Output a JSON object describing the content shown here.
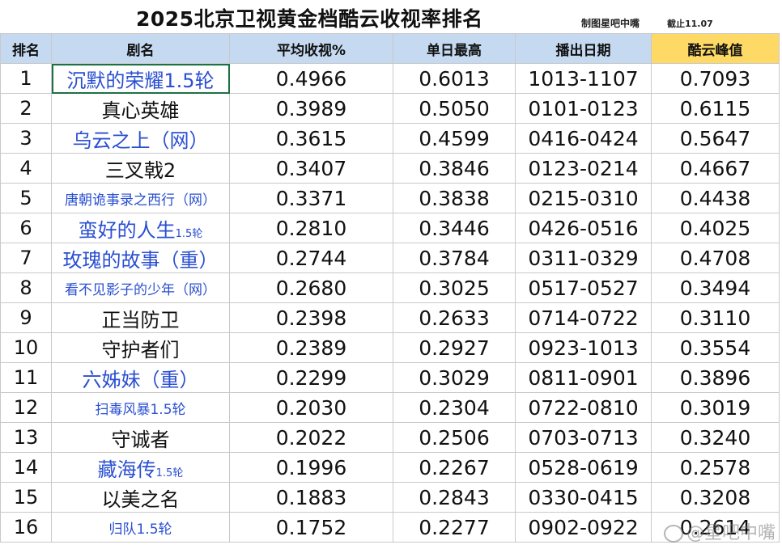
{
  "title": "2025北京卫视黄金档酷云收视率排名",
  "credit": "制图星吧中嘴",
  "cutoff": "截止11.07",
  "watermark": "@星吧中嘴",
  "headers": [
    "排名",
    "剧名",
    "平均收视%",
    "单日最高",
    "播出日期",
    "酷云峰值"
  ],
  "colors": {
    "header_bg": "#c5d9f1",
    "peak_header_bg": "#ffd966",
    "blue_text": "#2a4fd1",
    "selection": "#1e7145"
  },
  "rows": [
    {
      "rank": "1",
      "name": "沉默的荣耀1.5轮",
      "sub": "",
      "avg": "0.4966",
      "max": "0.6013",
      "dates": "1013-1107",
      "peak": "0.7093",
      "blue": true,
      "small": false
    },
    {
      "rank": "2",
      "name": "真心英雄",
      "sub": "",
      "avg": "0.3989",
      "max": "0.5050",
      "dates": "0101-0123",
      "peak": "0.6115",
      "blue": false,
      "small": false
    },
    {
      "rank": "3",
      "name": "乌云之上（网）",
      "sub": "",
      "avg": "0.3615",
      "max": "0.4599",
      "dates": "0416-0424",
      "peak": "0.5647",
      "blue": true,
      "small": false
    },
    {
      "rank": "4",
      "name": "三叉戟2",
      "sub": "",
      "avg": "0.3407",
      "max": "0.3846",
      "dates": "0123-0214",
      "peak": "0.4667",
      "blue": false,
      "small": false
    },
    {
      "rank": "5",
      "name": "唐朝诡事录之西行（网）",
      "sub": "",
      "avg": "0.3371",
      "max": "0.3838",
      "dates": "0215-0310",
      "peak": "0.4438",
      "blue": true,
      "small": true
    },
    {
      "rank": "6",
      "name": "蛮好的人生",
      "sub": "1.5轮",
      "avg": "0.2810",
      "max": "0.3446",
      "dates": "0426-0516",
      "peak": "0.4025",
      "blue": true,
      "small": false
    },
    {
      "rank": "7",
      "name": "玫瑰的故事（重）",
      "sub": "",
      "avg": "0.2744",
      "max": "0.3784",
      "dates": "0311-0329",
      "peak": "0.4708",
      "blue": true,
      "small": false
    },
    {
      "rank": "8",
      "name": "看不见影子的少年（网）",
      "sub": "",
      "avg": "0.2680",
      "max": "0.3025",
      "dates": "0517-0527",
      "peak": "0.3494",
      "blue": true,
      "small": true
    },
    {
      "rank": "9",
      "name": "正当防卫",
      "sub": "",
      "avg": "0.2398",
      "max": "0.2633",
      "dates": "0714-0722",
      "peak": "0.3110",
      "blue": false,
      "small": false
    },
    {
      "rank": "10",
      "name": "守护者们",
      "sub": "",
      "avg": "0.2389",
      "max": "0.2927",
      "dates": "0923-1013",
      "peak": "0.3554",
      "blue": false,
      "small": false
    },
    {
      "rank": "11",
      "name": "六姊妹（重）",
      "sub": "",
      "avg": "0.2299",
      "max": "0.3029",
      "dates": "0811-0901",
      "peak": "0.3896",
      "blue": true,
      "small": false
    },
    {
      "rank": "12",
      "name": "扫毒风暴1.5轮",
      "sub": "",
      "avg": "0.2030",
      "max": "0.2304",
      "dates": "0722-0810",
      "peak": "0.3019",
      "blue": true,
      "small": true
    },
    {
      "rank": "13",
      "name": "守诚者",
      "sub": "",
      "avg": "0.2022",
      "max": "0.2506",
      "dates": "0703-0713",
      "peak": "0.3240",
      "blue": false,
      "small": false
    },
    {
      "rank": "14",
      "name": "藏海传",
      "sub": "1.5轮",
      "avg": "0.1996",
      "max": "0.2267",
      "dates": "0528-0619",
      "peak": "0.2578",
      "blue": true,
      "small": false
    },
    {
      "rank": "15",
      "name": "以美之名",
      "sub": "",
      "avg": "0.1883",
      "max": "0.2843",
      "dates": "0330-0415",
      "peak": "0.3208",
      "blue": false,
      "small": false
    },
    {
      "rank": "16",
      "name": "归队1.5轮",
      "sub": "",
      "avg": "0.1752",
      "max": "0.2277",
      "dates": "0902-0922",
      "peak": "0.2614",
      "blue": true,
      "small": true
    }
  ]
}
